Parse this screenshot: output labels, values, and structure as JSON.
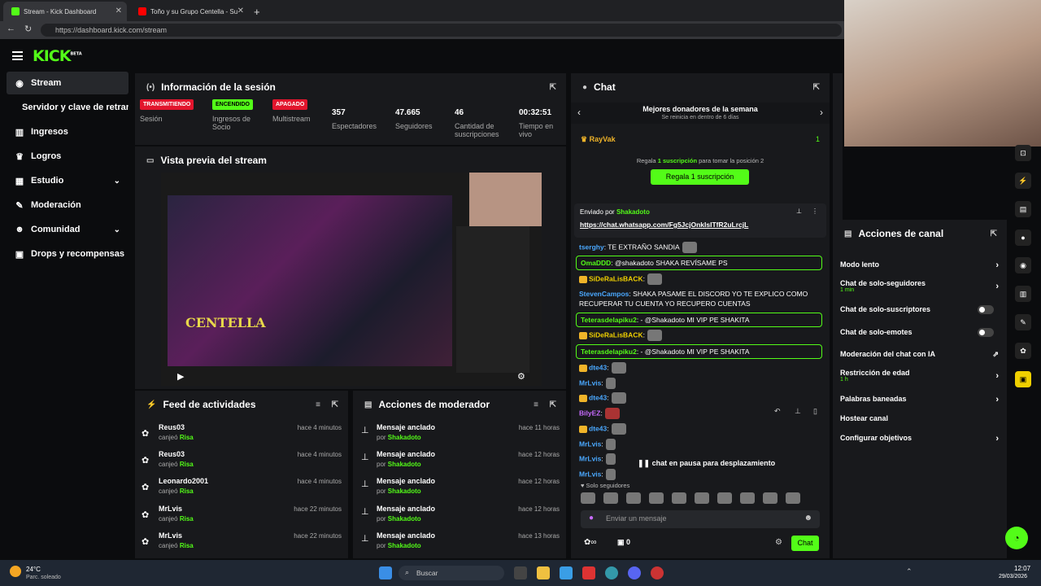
{
  "browser": {
    "tabs": [
      {
        "label": "Stream - Kick Dashboard",
        "active": true
      },
      {
        "label": "Toño y su Grupo Centella - Su",
        "active": false
      }
    ],
    "new_tab": "+",
    "url": "https://dashboard.kick.com/stream"
  },
  "brand": {
    "logo": "KICK",
    "tag": "BETA",
    "accent": "#53fc18"
  },
  "sidebar": {
    "items": [
      {
        "label": "Stream",
        "icon": "broadcast-icon",
        "active": true
      },
      {
        "label": "Servidor y clave de retransn",
        "icon": ""
      },
      {
        "label": "Ingresos",
        "icon": "chart-icon"
      },
      {
        "label": "Logros",
        "icon": "trophy-icon"
      },
      {
        "label": "Estudio",
        "icon": "grid-icon",
        "chevron": "⌄"
      },
      {
        "label": "Moderación",
        "icon": "wrench-icon"
      },
      {
        "label": "Comunidad",
        "icon": "people-icon",
        "chevron": "⌄"
      },
      {
        "label": "Drops y recompensas",
        "icon": "gift-icon"
      }
    ]
  },
  "session": {
    "title": "Información de la sesión",
    "badges": [
      "TRANSMITIENDO",
      "ENCENDIDO",
      "APAGADO"
    ],
    "badge_labels": [
      "Sesión",
      "Ingresos de Socio",
      "Multistream"
    ],
    "stats": [
      {
        "value": "357",
        "label": "Espectadores"
      },
      {
        "value": "47.665",
        "label": "Seguidores"
      },
      {
        "value": "46",
        "label": "Cantidad de suscripciones"
      },
      {
        "value": "00:32:51",
        "label": "Tiempo en vivo"
      }
    ]
  },
  "preview": {
    "title": "Vista previa del stream",
    "video_caption": "CENTELLA"
  },
  "feed": {
    "title": "Feed de actividades",
    "rows": [
      {
        "name": "Reus03",
        "action": "canjeó",
        "reward": "Risa",
        "time": "hace 4 minutos"
      },
      {
        "name": "Reus03",
        "action": "canjeó",
        "reward": "Risa",
        "time": "hace 4 minutos"
      },
      {
        "name": "Leonardo2001",
        "action": "canjeó",
        "reward": "Risa",
        "time": "hace 4 minutos"
      },
      {
        "name": "MrLvis",
        "action": "canjeó",
        "reward": "Risa",
        "time": "hace 22 minutos"
      },
      {
        "name": "MrLvis",
        "action": "canjeó",
        "reward": "Risa",
        "time": "hace 22 minutos"
      }
    ]
  },
  "mod": {
    "title": "Acciones de moderador",
    "rows": [
      {
        "name": "Mensaje anclado",
        "by": "por",
        "who": "Shakadoto",
        "time": "hace 11 horas"
      },
      {
        "name": "Mensaje anclado",
        "by": "por",
        "who": "Shakadoto",
        "time": "hace 12 horas"
      },
      {
        "name": "Mensaje anclado",
        "by": "por",
        "who": "Shakadoto",
        "time": "hace 12 horas"
      },
      {
        "name": "Mensaje anclado",
        "by": "por",
        "who": "Shakadoto",
        "time": "hace 12 horas"
      },
      {
        "name": "Mensaje anclado",
        "by": "por",
        "who": "Shakadoto",
        "time": "hace 13 horas"
      }
    ]
  },
  "chat": {
    "title": "Chat",
    "donors_title": "Mejores donadores de la semana",
    "donors_sub": "Se reinicia en dentro de 6 días",
    "top_donor": "RayVak",
    "top_count": "1",
    "gift_hint_pre": "Regala",
    "gift_hint_mid": "1 suscripción",
    "gift_hint_post": "para tomar la posición 2",
    "gift_button": "Regala 1 suscripción",
    "pinned_by": "Enviado por",
    "pinned_user": "Shakadoto",
    "pinned_link": "https://chat.whatsapp.com/Fg5JcjOnkIsITfR2uLrcjL",
    "messages": [
      {
        "user": "tserghy",
        "text": "TE EXTRAÑO SANDIA",
        "color": "#4aa8ff"
      },
      {
        "user": "OmaDDD",
        "text": "@shakadoto SHAKA REVÍSAME PS",
        "color": "#53fc18",
        "hl": true
      },
      {
        "user": "SiDeRaLisBACK",
        "text": "",
        "color": "#f0d000"
      },
      {
        "user": "StevenCampos",
        "text": "SHAKA PASAME EL DISCORD YO TE EXPLICO COMO RECUPERAR TU CUENTA YO RECUPERO CUENTAS",
        "color": "#4aa8ff"
      },
      {
        "user": "Teterasdelapiku2",
        "text": "@Shakadoto MI VIP PE SHAKITA",
        "color": "#53fc18",
        "hl": true
      },
      {
        "user": "SiDeRaLisBACK",
        "text": "",
        "color": "#f0d000"
      },
      {
        "user": "Teterasdelapiku2",
        "text": "@Shakadoto MI VIP PE SHAKITA",
        "color": "#53fc18",
        "hl": true
      },
      {
        "user": "dte43",
        "text": "",
        "color": "#4aa8ff"
      },
      {
        "user": "MrLvis",
        "text": "",
        "color": "#4aa8ff"
      },
      {
        "user": "dte43",
        "text": "",
        "color": "#4aa8ff"
      },
      {
        "user": "BilyEZ",
        "text": "",
        "color": "#c86bff"
      },
      {
        "user": "dte43",
        "text": "",
        "color": "#4aa8ff"
      },
      {
        "user": "MrLvis",
        "text": "",
        "color": "#4aa8ff"
      },
      {
        "user": "MrLvis",
        "text": "",
        "color": "#4aa8ff"
      },
      {
        "user": "MrLvis",
        "text": "",
        "color": "#4aa8ff"
      }
    ],
    "paused": "chat en pausa para desplazamiento",
    "followers_only": "Solo seguidores",
    "input_placeholder": "Enviar un mensaje",
    "points": "∞",
    "gift_count": "0",
    "send_label": "Chat"
  },
  "channel_actions": {
    "title": "Acciones de canal",
    "items": [
      {
        "label": "Modo lento",
        "control": "arrow"
      },
      {
        "label": "Chat de solo-seguidores",
        "sub": "1 min",
        "control": "arrow"
      },
      {
        "label": "Chat de solo-suscriptores",
        "control": "toggle"
      },
      {
        "label": "Chat de solo-emotes",
        "control": "toggle"
      },
      {
        "label": "Moderación del chat con IA",
        "control": "external"
      },
      {
        "label": "Restricción de edad",
        "sub": "1 h",
        "control": "arrow"
      },
      {
        "label": "Palabras baneadas",
        "control": "arrow"
      },
      {
        "label": "Hostear canal",
        "control": ""
      },
      {
        "label": "Configurar objetivos",
        "control": "arrow"
      }
    ]
  },
  "taskbar": {
    "weather_temp": "24°C",
    "weather_desc": "Parc. soleado",
    "search": "Buscar",
    "time": "12:07",
    "date": "29/03/2026"
  }
}
